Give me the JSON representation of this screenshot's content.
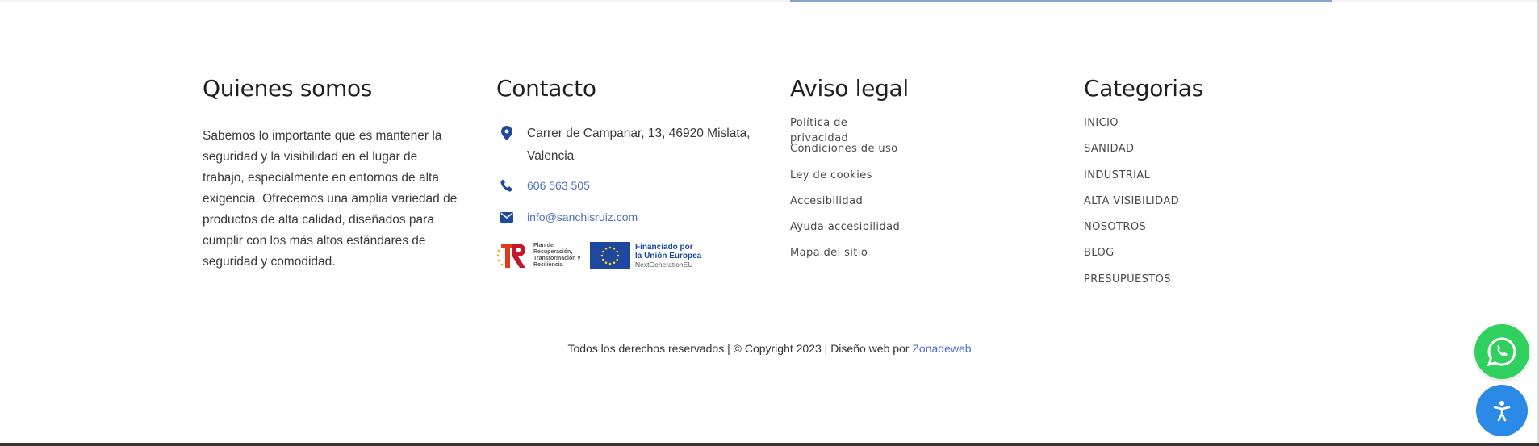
{
  "about": {
    "title": "Quienes somos",
    "text": "Sabemos lo importante que es mantener la seguridad y la visibilidad en el lugar de trabajo, especialmente en entornos de alta exigencia. Ofrecemos una amplia variedad de productos de alta calidad, diseñados para cumplir con los más altos estándares de seguridad y comodidad."
  },
  "contact": {
    "title": "Contacto",
    "address": "Carrer de Campanar, 13, 46920 Mislata, Valencia",
    "phone": "606 563 505",
    "email": "info@sanchisruiz.com",
    "logo_tr": "Plan de Recuperación, Transformación y Resiliencia",
    "logo_eu_line1": "Financiado por",
    "logo_eu_line2": "la Unión Europea",
    "logo_eu_line3": "NextGenerationEU",
    "icon_color": "#1e4a9b"
  },
  "legal": {
    "title": "Aviso legal",
    "items": [
      "Política de privacidad",
      "Condiciones de uso",
      "Ley de cookies",
      "Accesibilidad",
      "Ayuda accesibilidad",
      "Mapa del sitio"
    ]
  },
  "categories": {
    "title": "Categorias",
    "items": [
      "INICIO",
      "SANIDAD",
      "INDUSTRIAL",
      "ALTA VISIBILIDAD",
      "NOSOTROS",
      "BLOG",
      "PRESUPUESTOS"
    ]
  },
  "footer": {
    "copyright": "Todos los derechos reservados | © Copyright 2023  | Diseño web por ",
    "credit_link": "Zonadeweb"
  },
  "widgets": {
    "whatsapp_icon": "whatsapp-icon",
    "whatsapp_color": "#2fd05d",
    "accessibility_icon": "accessibility-icon",
    "accessibility_color": "#2b8ae6"
  }
}
